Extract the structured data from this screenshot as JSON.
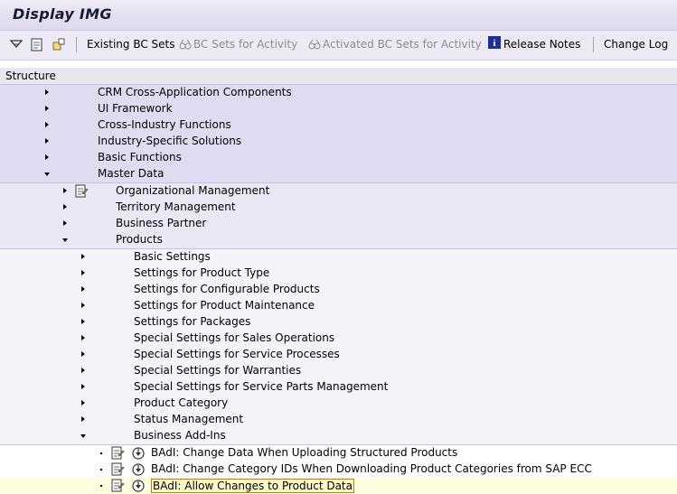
{
  "window": {
    "title": "Display IMG"
  },
  "toolbar": {
    "existing_bc_sets": "Existing BC Sets",
    "bc_sets_for_activity": "BC Sets for Activity",
    "activated_bc_sets_for_activity": "Activated BC Sets for Activity",
    "release_notes": "Release Notes",
    "change_log": "Change Log"
  },
  "structure": {
    "header": "Structure"
  },
  "tree": {
    "level1": [
      "CRM Cross-Application Components",
      "UI Framework",
      "Cross-Industry Functions",
      "Industry-Specific Solutions",
      "Basic Functions",
      "Master Data"
    ],
    "level2": [
      "Organizational Management",
      "Territory Management",
      "Business Partner",
      "Products"
    ],
    "level3": [
      "Basic Settings",
      "Settings for Product Type",
      "Settings for Configurable Products",
      "Settings for Product Maintenance",
      "Settings for Packages",
      "Special Settings for Sales Operations",
      "Special Settings for Service Processes",
      "Special Settings for Warranties",
      "Special Settings for Service Parts Management",
      "Product Category",
      "Status Management",
      "Business Add-Ins"
    ],
    "level4": [
      "BAdI: Change Data When Uploading Structured Products",
      "BAdI: Change Category IDs When Downloading Product Categories from SAP ECC",
      "BAdI: Allow Changes to Product Data"
    ]
  },
  "colors": {
    "band1": "#dddcf0",
    "band2": "#e9e8f4",
    "band3": "#f4f3fa",
    "band4": "#ffffff",
    "selected_row": "#fffde0"
  }
}
